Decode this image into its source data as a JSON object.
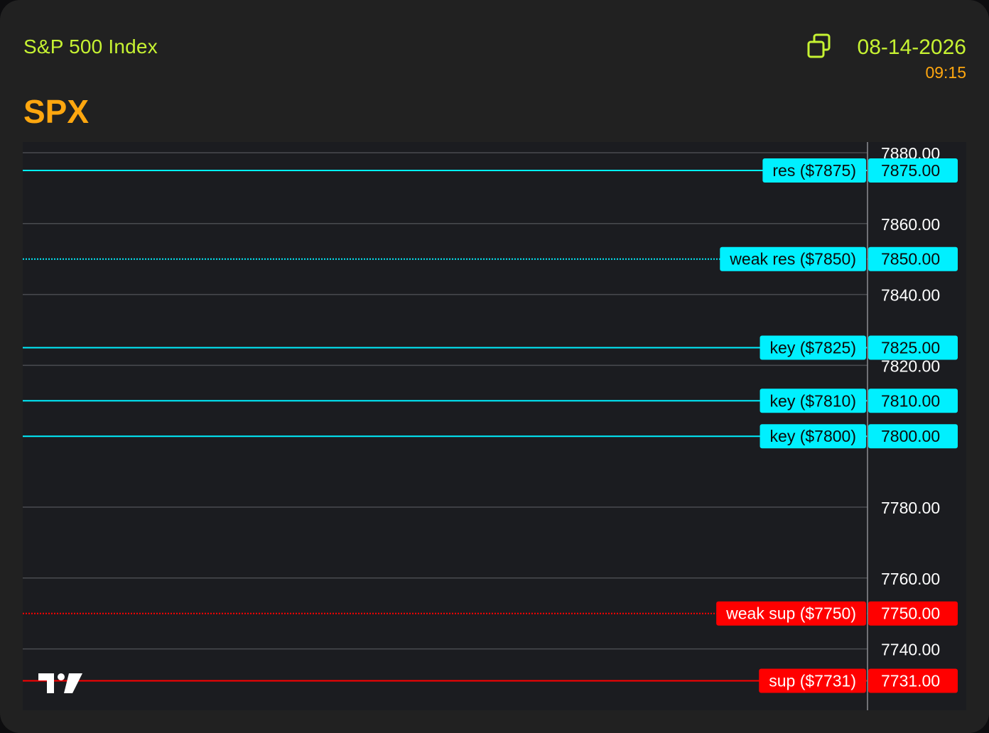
{
  "header": {
    "index_name": "S&P 500 Index",
    "ticker": "SPX",
    "date": "08-14-2026",
    "time": "09:15",
    "copy_icon": "copy-icon"
  },
  "colors": {
    "index_name": "#c6f232",
    "ticker": "#ffa70f",
    "resistance": "#00f0ff",
    "support": "#ff0000",
    "grid": "#4a4b50",
    "axis_text": "#ffffff",
    "chart_bg": "#1b1c20"
  },
  "watermark": {
    "icon": "tradingview-logo-icon"
  },
  "chart_data": {
    "type": "line",
    "title": "",
    "xlabel": "",
    "ylabel": "",
    "ylim": [
      7728,
      7883
    ],
    "grid": true,
    "y_ticks": [
      7880,
      7860,
      7840,
      7820,
      7780,
      7760,
      7740
    ],
    "y_tick_labels": [
      "7880.00",
      "7860.00",
      "7840.00",
      "7820.00",
      "7780.00",
      "7760.00",
      "7740.00"
    ],
    "levels": [
      {
        "label": "res ($7875)",
        "value": 7875,
        "value_label": "7875.00",
        "color": "#00f0ff",
        "style": "solid"
      },
      {
        "label": "weak res ($7850)",
        "value": 7850,
        "value_label": "7850.00",
        "color": "#00f0ff",
        "style": "dotted"
      },
      {
        "label": "key ($7825)",
        "value": 7825,
        "value_label": "7825.00",
        "color": "#00f0ff",
        "style": "solid"
      },
      {
        "label": "key ($7810)",
        "value": 7810,
        "value_label": "7810.00",
        "color": "#00f0ff",
        "style": "solid"
      },
      {
        "label": "key ($7800)",
        "value": 7800,
        "value_label": "7800.00",
        "color": "#00f0ff",
        "style": "solid"
      },
      {
        "label": "weak sup ($7750)",
        "value": 7750,
        "value_label": "7750.00",
        "color": "#ff0000",
        "style": "dotted"
      },
      {
        "label": "sup ($7731)",
        "value": 7731,
        "value_label": "7731.00",
        "color": "#ff0000",
        "style": "solid"
      }
    ]
  }
}
